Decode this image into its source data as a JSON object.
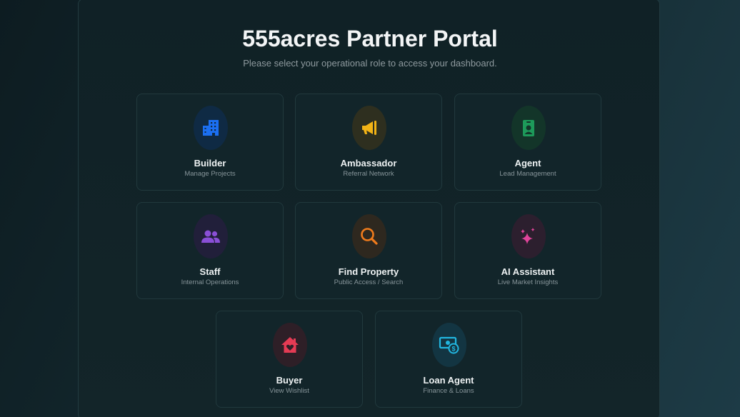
{
  "header": {
    "title": "555acres Partner Portal",
    "subtitle": "Please select your operational role to access your dashboard."
  },
  "roles": [
    {
      "title": "Builder",
      "subtitle": "Manage Projects",
      "icon": "building-icon",
      "color": "#1b6ff2"
    },
    {
      "title": "Ambassador",
      "subtitle": "Referral Network",
      "icon": "megaphone-icon",
      "color": "#f2b316"
    },
    {
      "title": "Agent",
      "subtitle": "Lead Management",
      "icon": "id-badge-icon",
      "color": "#1d9a5a"
    },
    {
      "title": "Staff",
      "subtitle": "Internal Operations",
      "icon": "users-icon",
      "color": "#8a4fd6"
    },
    {
      "title": "Find Property",
      "subtitle": "Public Access / Search",
      "icon": "search-icon",
      "color": "#f07b1c"
    },
    {
      "title": "AI Assistant",
      "subtitle": "Live Market Insights",
      "icon": "sparkles-icon",
      "color": "#e0449a"
    },
    {
      "title": "Buyer",
      "subtitle": "View Wishlist",
      "icon": "house-heart-icon",
      "color": "#e43b54"
    },
    {
      "title": "Loan Agent",
      "subtitle": "Finance & Loans",
      "icon": "money-icon",
      "color": "#22b6e0"
    }
  ]
}
